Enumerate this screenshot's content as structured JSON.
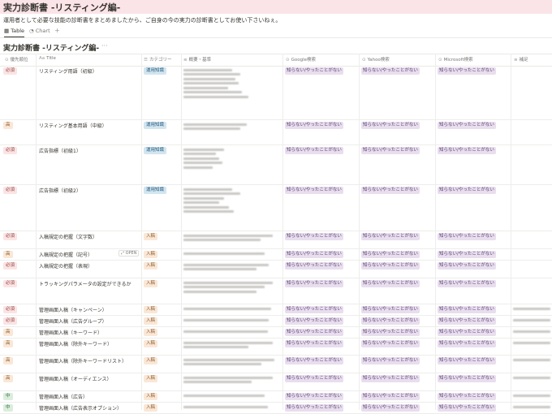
{
  "page": {
    "title": "実力診断書 -リスティング編-",
    "description": "運用者として必要な技能の診断書をまとめましたから、ご自身の今の実力の診断書としてお使い下さいねぇ。"
  },
  "views": {
    "table_label": "Table",
    "chart_label": "Chart",
    "add_label": "+"
  },
  "database": {
    "title": "実力診断書 -リスティング編-",
    "more": "···",
    "open_label": "OPEN"
  },
  "columns": {
    "priority": "優先順位",
    "title": "Title",
    "category": "カテゴリー",
    "summary": "概要・基準",
    "google": "Google検索",
    "yahoo": "Yahoo検索",
    "microsoft": "Microsoft検索",
    "supplement": "補足"
  },
  "rows": [
    {
      "priority": "必須",
      "title": "リスティング用語（初級）",
      "category": "運用知識",
      "google": "知らない/やったことがない",
      "yahoo": "知らない/やったことがない",
      "microsoft": "知らない/やったことがない"
    },
    {
      "priority": "高",
      "title": "リスティング基本用語（中級）",
      "category": "運用知識",
      "google": "知らない/やったことがない",
      "yahoo": "知らない/やったことがない",
      "microsoft": "知らない/やったことがない"
    },
    {
      "priority": "必須",
      "title": "広告指標（初級1）",
      "category": "運用知識",
      "google": "知らない/やったことがない",
      "yahoo": "知らない/やったことがない",
      "microsoft": "知らない/やったことがない"
    },
    {
      "priority": "必須",
      "title": "広告指標（初級2）",
      "category": "運用知識",
      "google": "知らない/やったことがない",
      "yahoo": "知らない/やったことがない",
      "microsoft": "知らない/やったことがない"
    },
    {
      "priority": "必須",
      "title": "入稿規定の把握（文字数）",
      "category": "入稿",
      "google": "知らない/やったことがない",
      "yahoo": "知らない/やったことがない",
      "microsoft": "知らない/やったことがない"
    },
    {
      "priority": "高",
      "title": "入稿規定の把握（記号）",
      "category": "入稿",
      "google": "知らない/やったことがない",
      "yahoo": "知らない/やったことがない",
      "microsoft": "知らない/やったことがない"
    },
    {
      "priority": "必須",
      "title": "入稿規定の把握（表現）",
      "category": "入稿",
      "google": "知らない/やったことがない",
      "yahoo": "知らない/やったことがない",
      "microsoft": "知らない/やったことがない"
    },
    {
      "priority": "必須",
      "title": "トラッキングパラメータの設定ができるか",
      "category": "入稿",
      "google": "知らない/やったことがない",
      "yahoo": "知らない/やったことがない",
      "microsoft": "知らない/やったことがない"
    },
    {
      "priority": "必須",
      "title": "管理画面入稿（キャンペーン）",
      "category": "入稿",
      "google": "知らない/やったことがない",
      "yahoo": "知らない/やったことがない",
      "microsoft": "知らない/やったことがない"
    },
    {
      "priority": "必須",
      "title": "管理画面入稿（広告グループ）",
      "category": "入稿",
      "google": "知らない/やったことがない",
      "yahoo": "知らない/やったことがない",
      "microsoft": "知らない/やったことがない"
    },
    {
      "priority": "高",
      "title": "管理画面入稿（キーワード）",
      "category": "入稿",
      "google": "知らない/やったことがない",
      "yahoo": "知らない/やったことがない",
      "microsoft": "知らない/やったことがない"
    },
    {
      "priority": "高",
      "title": "管理画面入稿（除外キーワード）",
      "category": "入稿",
      "google": "知らない/やったことがない",
      "yahoo": "知らない/やったことがない",
      "microsoft": "知らない/やったことがない"
    },
    {
      "priority": "高",
      "title": "管理画面入稿（除外キーワードリスト）",
      "category": "入稿",
      "google": "知らない/やったことがない",
      "yahoo": "知らない/やったことがない",
      "microsoft": "知らない/やったことがない"
    },
    {
      "priority": "高",
      "title": "管理画面入稿（オーディエンス）",
      "category": "入稿",
      "google": "知らない/やったことがない",
      "yahoo": "知らない/やったことがない",
      "microsoft": "知らない/やったことがない"
    },
    {
      "priority": "中",
      "title": "管理画面入稿（広告）",
      "category": "入稿",
      "google": "知らない/やったことがない",
      "yahoo": "知らない/やったことがない",
      "microsoft": "知らない/やったことがない"
    },
    {
      "priority": "中",
      "title": "管理画面入稿（広告表示オプション）",
      "category": "入稿",
      "google": "知らない/やったことがない",
      "yahoo": "知らない/やったことがない",
      "microsoft": "知らない/やったことがない"
    }
  ]
}
